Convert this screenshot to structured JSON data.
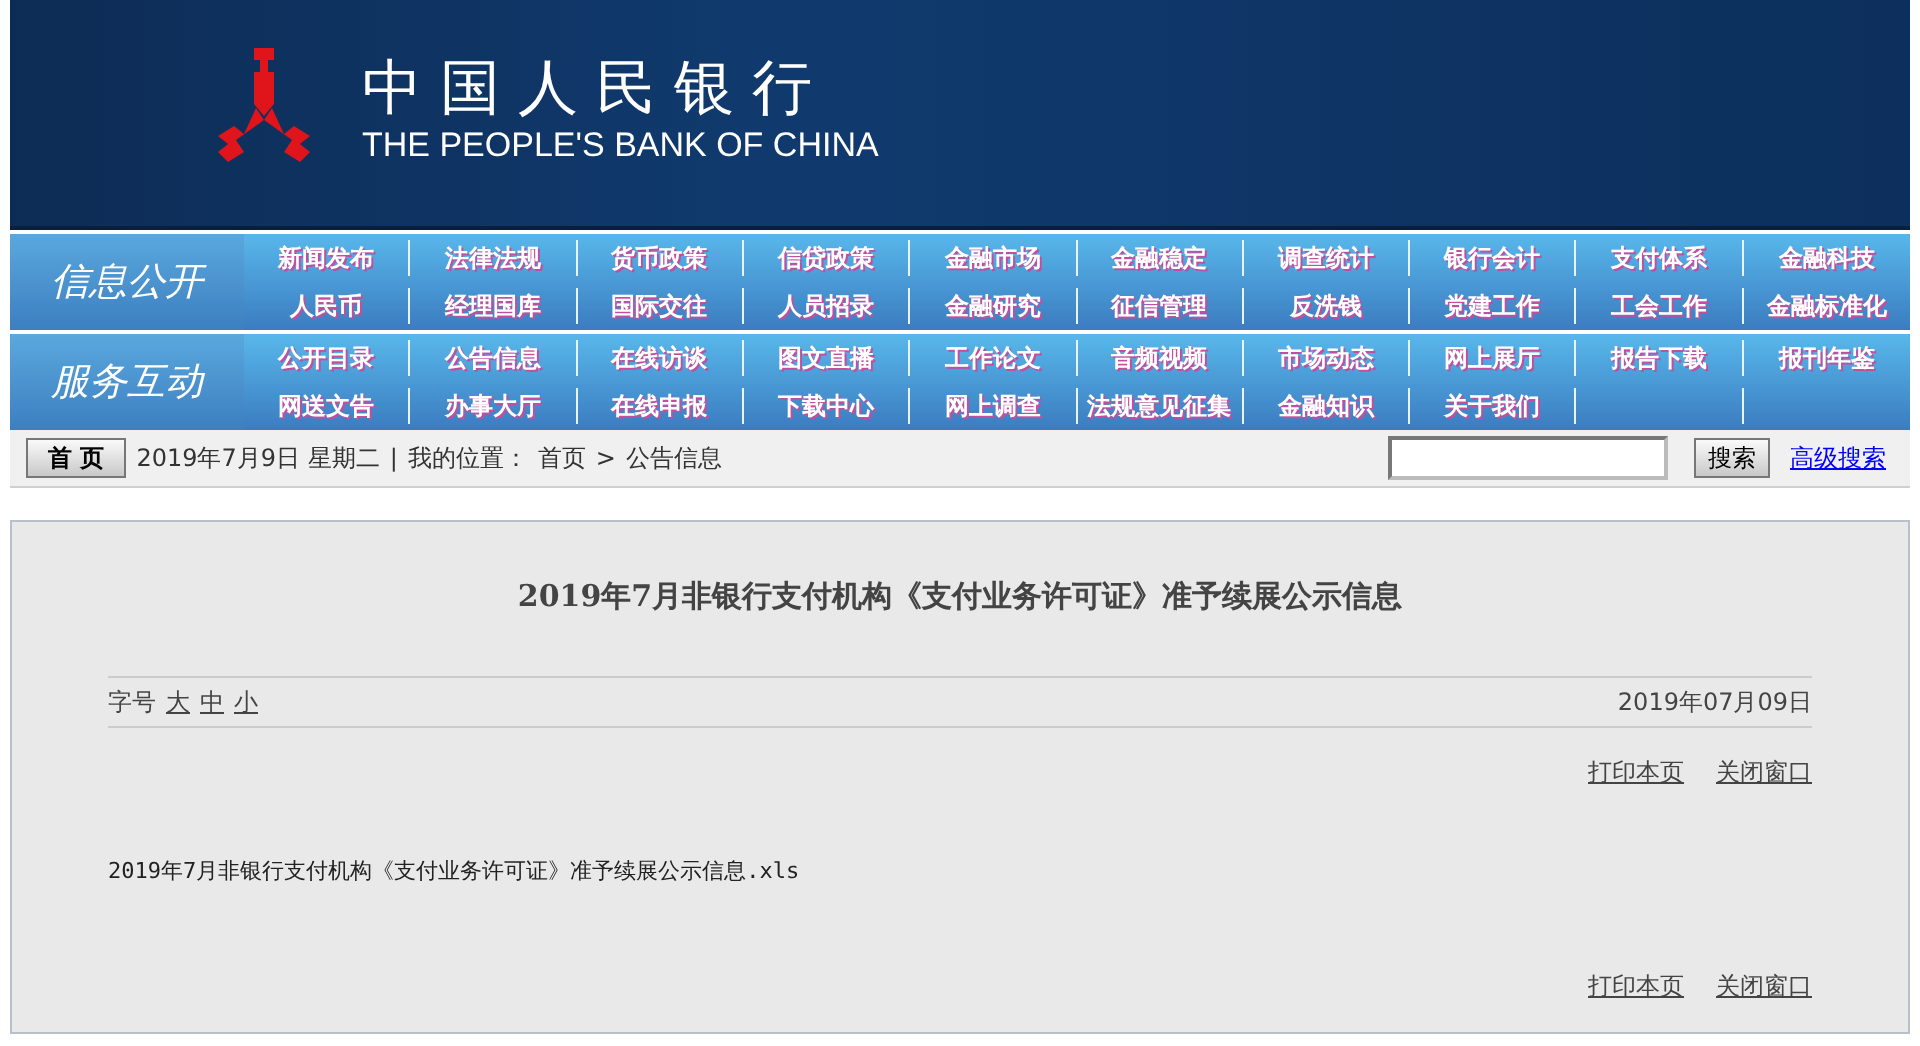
{
  "header": {
    "name_cn": "中国人民银行",
    "name_en": "THE PEOPLE'S BANK OF CHINA"
  },
  "nav_sections": [
    {
      "title": "信息公开",
      "rows": [
        [
          "新闻发布",
          "法律法规",
          "货币政策",
          "信贷政策",
          "金融市场",
          "金融稳定",
          "调查统计",
          "银行会计",
          "支付体系",
          "金融科技"
        ],
        [
          "人民币",
          "经理国库",
          "国际交往",
          "人员招录",
          "金融研究",
          "征信管理",
          "反洗钱",
          "党建工作",
          "工会工作",
          "金融标准化"
        ]
      ]
    },
    {
      "title": "服务互动",
      "rows": [
        [
          "公开目录",
          "公告信息",
          "在线访谈",
          "图文直播",
          "工作论文",
          "音频视频",
          "市场动态",
          "网上展厅",
          "报告下载",
          "报刊年鉴"
        ],
        [
          "网送文告",
          "办事大厅",
          "在线申报",
          "下载中心",
          "网上调查",
          "法规意见征集",
          "金融知识",
          "关于我们"
        ]
      ]
    }
  ],
  "breadcrumb_bar": {
    "home_button": "首 页",
    "date": "2019年7月9日 星期二",
    "separator": "|",
    "location_label": "我的位置：",
    "crumbs": [
      "首页",
      "公告信息"
    ],
    "crumb_separator": ">",
    "search_button": "搜索",
    "advanced_search": "高级搜索"
  },
  "article": {
    "title": "2019年7月非银行支付机构《支付业务许可证》准予续展公示信息",
    "font_size_label": "字号",
    "font_sizes": [
      "大",
      "中",
      "小"
    ],
    "date": "2019年07月09日",
    "top_links": [
      "打印本页",
      "关闭窗口"
    ],
    "attachment": "2019年7月非银行支付机构《支付业务许可证》准予续展公示信息.xls",
    "bottom_links": [
      "打印本页",
      "关闭窗口"
    ]
  }
}
